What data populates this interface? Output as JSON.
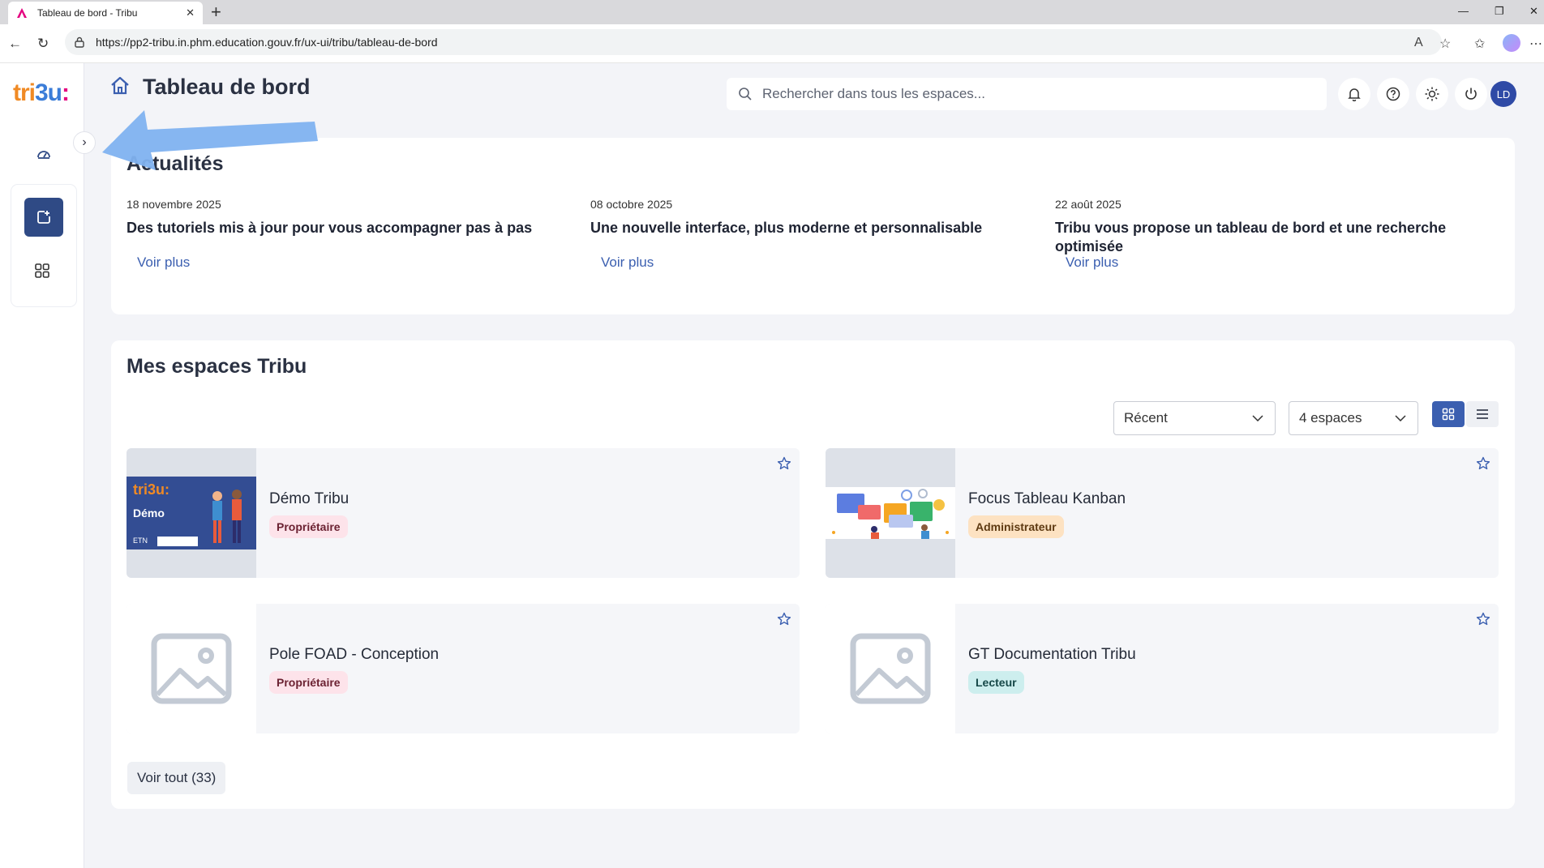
{
  "browser": {
    "tab_title": "Tableau de bord - Tribu",
    "url": "https://pp2-tribu.in.phm.education.gouv.fr/ux-ui/tribu/tableau-de-bord"
  },
  "app": {
    "logo": {
      "part1": "tri",
      "part2": "3u",
      "part3": ":"
    },
    "page_title": "Tableau de bord",
    "search_placeholder": "Rechercher dans tous les espaces...",
    "avatar_initials": "LD",
    "colors": {
      "primary": "#2f4a85",
      "link": "#3b5fb0"
    }
  },
  "news": {
    "title": "Actualités",
    "items": [
      {
        "date": "18 novembre 2025",
        "title": "Des tutoriels mis à jour pour vous accompagner pas à pas",
        "more": "Voir plus"
      },
      {
        "date": "08 octobre 2025",
        "title": "Une nouvelle interface, plus moderne et personnalisable",
        "more": "Voir plus"
      },
      {
        "date": "22 août 2025",
        "title": "Tribu vous propose un tableau de bord et une recherche optimisée",
        "more": "Voir plus"
      }
    ]
  },
  "spaces": {
    "title": "Mes espaces Tribu",
    "sort_value": "Récent",
    "count_value": "4 espaces",
    "items": [
      {
        "name": "Démo Tribu",
        "role": "Propriétaire",
        "thumb_text": "Démo",
        "thumb_brand": "tri3u:",
        "thumb_footer": "ETN"
      },
      {
        "name": "Focus Tableau Kanban",
        "role": "Administrateur"
      },
      {
        "name": "Pole FOAD - Conception",
        "role": "Propriétaire"
      },
      {
        "name": "GT Documentation Tribu",
        "role": "Lecteur"
      }
    ],
    "see_all": "Voir tout (33)"
  }
}
